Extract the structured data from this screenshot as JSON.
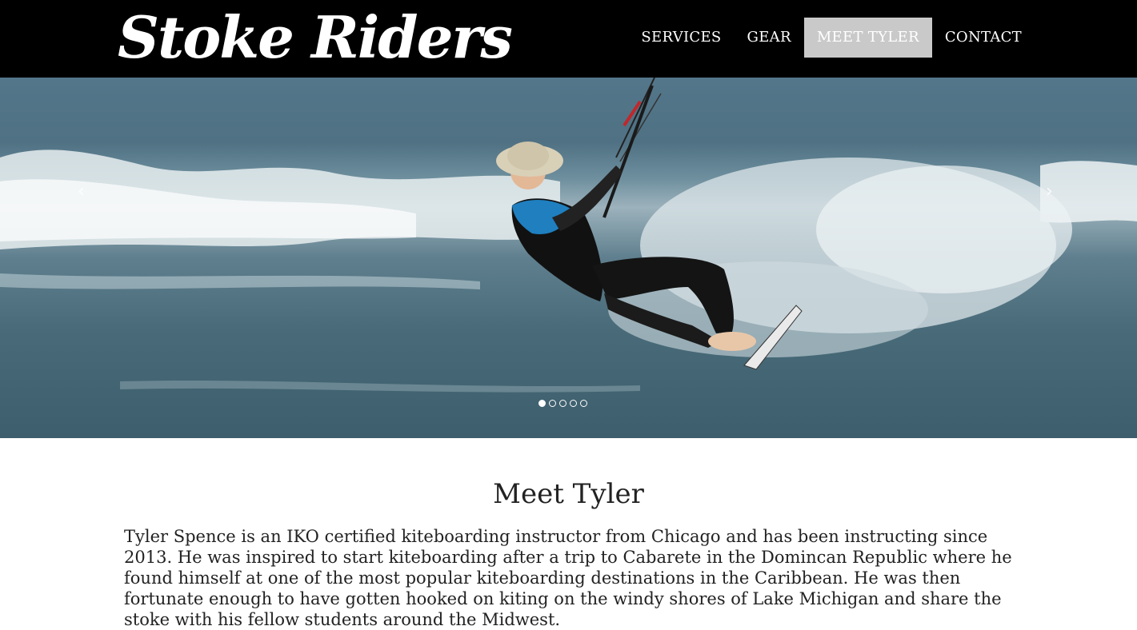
{
  "site": {
    "logo": "Stoke Riders"
  },
  "nav": {
    "items": [
      "SERVICES",
      "GEAR",
      "MEET TYLER",
      "CONTACT"
    ],
    "active": "MEET TYLER"
  },
  "carousel": {
    "prev_icon": "chevron-left-icon",
    "next_icon": "chevron-right-icon",
    "slide_count": 5,
    "active_slide": 1
  },
  "main": {
    "title": "Meet Tyler",
    "paragraph": "Tyler Spence is an IKO certified kiteboarding instructor from Chicago and has been instructing since 2013. He was inspired to start kiteboarding after a trip to Cabarete in the Domincan Republic where he found himself at one of the most popular kiteboarding destinations in the Caribbean. He was then fortunate enough to have gotten hooked on kiting on the windy shores of Lake Michigan and share the stoke with his fellow students around the Midwest."
  }
}
